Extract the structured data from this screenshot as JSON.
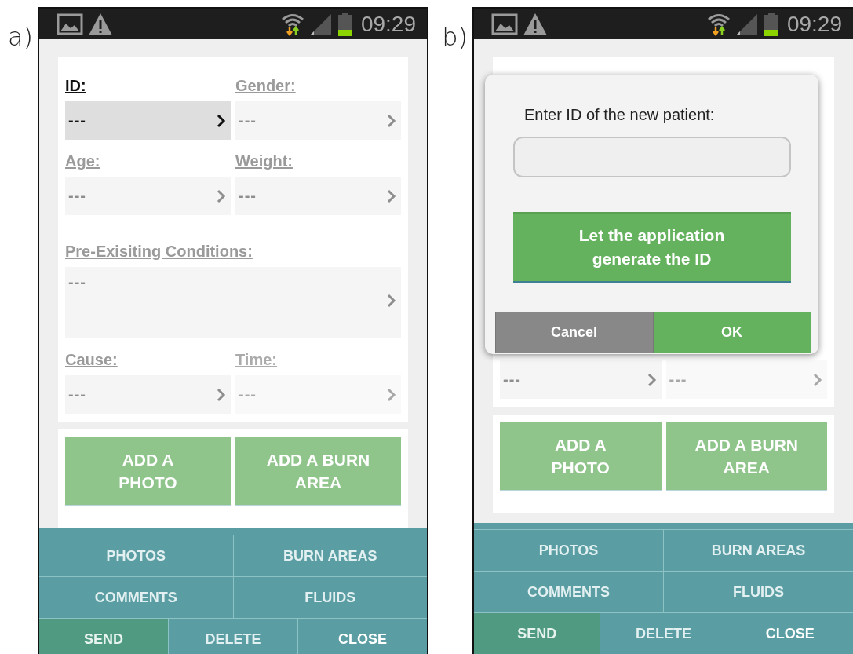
{
  "panels": [
    {
      "label": "a)",
      "status_bar": {
        "time": "09:29"
      },
      "form": {
        "rows": [
          [
            {
              "label": "ID:",
              "value": "---",
              "selected": true,
              "disabled": false
            },
            {
              "label": "Gender:",
              "value": "---",
              "selected": false,
              "disabled": false
            }
          ],
          [
            {
              "label": "Age:",
              "value": "---",
              "selected": false,
              "disabled": false
            },
            {
              "label": "Weight:",
              "value": "---",
              "selected": false,
              "disabled": false
            }
          ],
          [
            {
              "label": "Pre-Exisiting Conditions:",
              "value": "---",
              "selected": false,
              "disabled": false,
              "kind": "tall"
            }
          ],
          [
            {
              "label": "Cause:",
              "value": "---",
              "selected": false,
              "disabled": false
            },
            {
              "label": "Time:",
              "value": "---",
              "selected": false,
              "disabled": true
            }
          ]
        ]
      },
      "actions": [
        {
          "label": "ADD A\nPHOTO",
          "disabled": true
        },
        {
          "label": "ADD A BURN\nAREA",
          "disabled": true
        }
      ],
      "nav": [
        [
          {
            "label": "PHOTOS",
            "kind": "tab",
            "disabled": true
          },
          {
            "label": "BURN AREAS",
            "kind": "tab",
            "disabled": true
          }
        ],
        [
          {
            "label": "COMMENTS",
            "kind": "tab",
            "disabled": true
          },
          {
            "label": "FLUIDS",
            "kind": "tab",
            "disabled": true
          }
        ],
        [
          {
            "label": "SEND",
            "kind": "send",
            "disabled": true
          },
          {
            "label": "DELETE",
            "kind": "tab",
            "disabled": true
          },
          {
            "label": "CLOSE",
            "kind": "tab",
            "disabled": false
          }
        ]
      ]
    },
    {
      "label": "b)",
      "status_bar": {
        "time": "09:29"
      },
      "form": {
        "rows": [
          [
            {
              "value": "---",
              "selected": false,
              "disabled": false
            },
            {
              "value": "---",
              "selected": false,
              "disabled": true
            }
          ]
        ]
      },
      "dialog": {
        "prompt": "Enter ID of the new patient:",
        "generate_button": "Let the application generate the ID",
        "buttons": [
          {
            "label": "Cancel",
            "kind": "cancel"
          },
          {
            "label": "OK",
            "kind": "ok"
          }
        ]
      },
      "actions": [
        {
          "label": "ADD A\nPHOTO",
          "disabled": true
        },
        {
          "label": "ADD A BURN\nAREA",
          "disabled": true
        }
      ],
      "nav": [
        [
          {
            "label": "PHOTOS",
            "kind": "tab",
            "disabled": true
          },
          {
            "label": "BURN AREAS",
            "kind": "tab",
            "disabled": true
          }
        ],
        [
          {
            "label": "COMMENTS",
            "kind": "tab",
            "disabled": true
          },
          {
            "label": "FLUIDS",
            "kind": "tab",
            "disabled": true
          }
        ],
        [
          {
            "label": "SEND",
            "kind": "send",
            "disabled": true
          },
          {
            "label": "DELETE",
            "kind": "tab",
            "disabled": true
          },
          {
            "label": "CLOSE",
            "kind": "tab",
            "disabled": false
          }
        ]
      ]
    }
  ]
}
